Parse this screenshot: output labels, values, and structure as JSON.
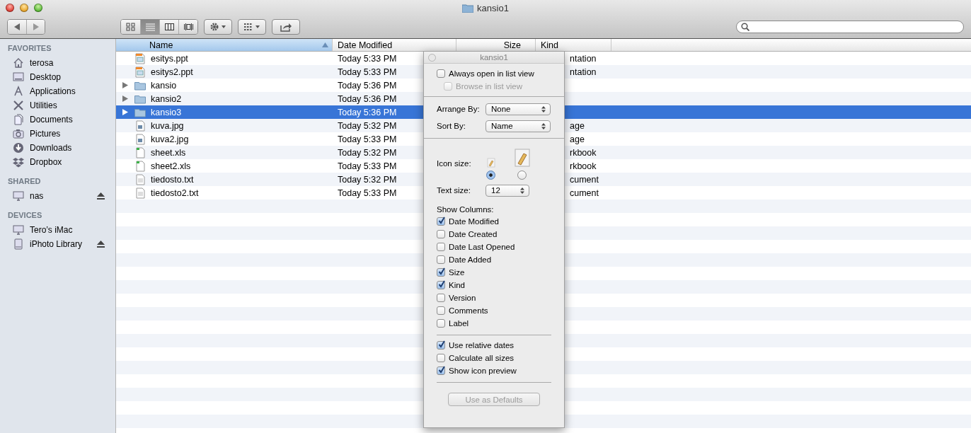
{
  "window": {
    "title": "kansio1"
  },
  "toolbar": {
    "view_modes": [
      {
        "kind": "icons",
        "selected": false
      },
      {
        "kind": "list",
        "selected": true
      },
      {
        "kind": "columns",
        "selected": false
      },
      {
        "kind": "coverflow",
        "selected": false
      }
    ]
  },
  "sidebar": {
    "sections": [
      {
        "title": "FAVORITES",
        "items": [
          {
            "kind": "home",
            "label": "terosa",
            "eject": false
          },
          {
            "kind": "desktop",
            "label": "Desktop",
            "eject": false
          },
          {
            "kind": "apps",
            "label": "Applications",
            "eject": false
          },
          {
            "kind": "tools",
            "label": "Utilities",
            "eject": false
          },
          {
            "kind": "docs",
            "label": "Documents",
            "eject": false
          },
          {
            "kind": "camera",
            "label": "Pictures",
            "eject": false
          },
          {
            "kind": "download",
            "label": "Downloads",
            "eject": false
          },
          {
            "kind": "box",
            "label": "Dropbox",
            "eject": false
          }
        ]
      },
      {
        "title": "SHARED",
        "items": [
          {
            "kind": "monitor",
            "label": "nas",
            "eject": true
          }
        ]
      },
      {
        "title": "DEVICES",
        "items": [
          {
            "kind": "monitor",
            "label": "Tero’s iMac",
            "eject": false
          },
          {
            "kind": "disk",
            "label": "iPhoto Library",
            "eject": true
          }
        ]
      }
    ]
  },
  "table": {
    "columns": [
      {
        "label": "Name",
        "selected": true
      },
      {
        "label": "Date Modified",
        "selected": false
      },
      {
        "label": "Size",
        "selected": false
      },
      {
        "label": "Kind",
        "selected": false
      }
    ],
    "rows": [
      {
        "kind": "presentation",
        "name": "esitys.ppt",
        "date_modified": "Today 5:33 PM",
        "kind_column": "ntation",
        "selected": false
      },
      {
        "kind": "presentation",
        "name": "esitys2.ppt",
        "date_modified": "Today 5:33 PM",
        "kind_column": "ntation",
        "selected": false
      },
      {
        "kind": "folder",
        "name": "kansio",
        "date_modified": "Today 5:36 PM",
        "selected": false
      },
      {
        "kind": "folder",
        "name": "kansio2",
        "date_modified": "Today 5:36 PM",
        "selected": false
      },
      {
        "kind": "folder",
        "name": "kansio3",
        "date_modified": "Today 5:36 PM",
        "selected": true
      },
      {
        "kind": "image",
        "name": "kuva.jpg",
        "date_modified": "Today 5:32 PM",
        "kind_column": "age",
        "selected": false
      },
      {
        "kind": "image",
        "name": "kuva2.jpg",
        "date_modified": "Today 5:33 PM",
        "kind_column": "age",
        "selected": false
      },
      {
        "kind": "spreadsheet",
        "name": "sheet.xls",
        "date_modified": "Today 5:32 PM",
        "kind_column": "rkbook",
        "selected": false
      },
      {
        "kind": "spreadsheet",
        "name": "sheet2.xls",
        "date_modified": "Today 5:33 PM",
        "kind_column": "rkbook",
        "selected": false
      },
      {
        "kind": "text",
        "name": "tiedosto.txt",
        "date_modified": "Today 5:32 PM",
        "kind_column": "cument",
        "selected": false
      },
      {
        "kind": "text",
        "name": "tiedosto2.txt",
        "date_modified": "Today 5:33 PM",
        "kind_column": "cument",
        "selected": false
      }
    ]
  },
  "view_options": {
    "title": "kansio1",
    "top_options": [
      {
        "label": "Always open in list view",
        "checked": false,
        "disabled": false
      },
      {
        "label": "Browse in list view",
        "checked": false,
        "disabled": true
      }
    ],
    "arrange_by": {
      "label": "Arrange By:",
      "value": "None"
    },
    "sort_by": {
      "label": "Sort By:",
      "value": "Name"
    },
    "icon_size": {
      "label": "Icon size:",
      "options": [
        {
          "selected": true
        },
        {
          "selected": false
        }
      ]
    },
    "text_size": {
      "label": "Text size:",
      "value": "12"
    },
    "show_columns": {
      "title": "Show Columns:",
      "items": [
        {
          "label": "Date Modified",
          "checked": true
        },
        {
          "label": "Date Created",
          "checked": false
        },
        {
          "label": "Date Last Opened",
          "checked": false
        },
        {
          "label": "Date Added",
          "checked": false
        },
        {
          "label": "Size",
          "checked": true
        },
        {
          "label": "Kind",
          "checked": true
        },
        {
          "label": "Version",
          "checked": false
        },
        {
          "label": "Comments",
          "checked": false
        },
        {
          "label": "Label",
          "checked": false
        }
      ]
    },
    "options": [
      {
        "label": "Use relative dates",
        "checked": true
      },
      {
        "label": "Calculate all sizes",
        "checked": false
      },
      {
        "label": "Show icon preview",
        "checked": true
      }
    ],
    "defaults_button": {
      "label": "Use as Defaults",
      "disabled": true
    }
  }
}
